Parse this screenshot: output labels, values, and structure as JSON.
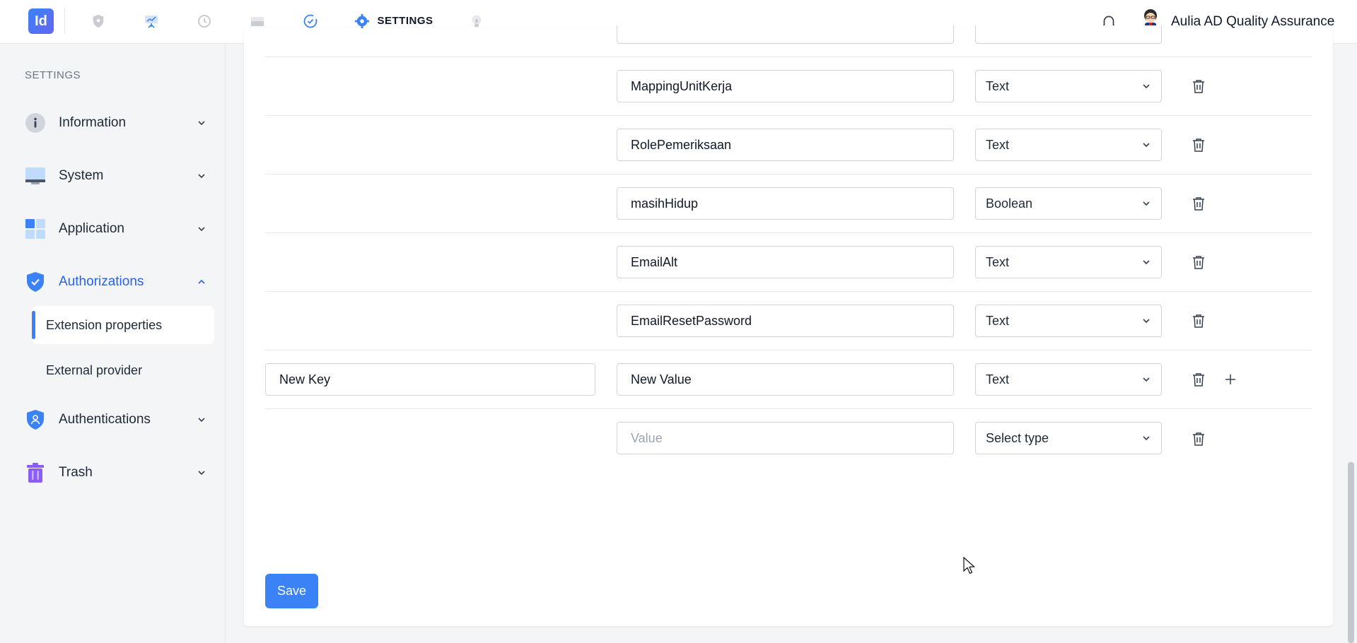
{
  "topbar": {
    "logo_text": "Id",
    "settings_label": "SETTINGS",
    "user_name": "Aulia AD Quality Assurance",
    "nav_icons": [
      "shield-icon",
      "presentation-icon",
      "history-icon",
      "drive-icon",
      "check-circle-icon",
      "gear-icon",
      "bulb-icon"
    ]
  },
  "sidebar": {
    "title": "SETTINGS",
    "items": [
      {
        "label": "Information",
        "icon": "info-icon"
      },
      {
        "label": "System",
        "icon": "monitor-icon"
      },
      {
        "label": "Application",
        "icon": "grid-icon"
      },
      {
        "label": "Authorizations",
        "icon": "shield-check-icon"
      },
      {
        "label": "Authentications",
        "icon": "shield-user-icon"
      },
      {
        "label": "Trash",
        "icon": "trash-icon"
      }
    ],
    "sub_items": [
      {
        "label": "Extension properties"
      },
      {
        "label": "External provider"
      }
    ],
    "accent": "#2563eb"
  },
  "rows": [
    {
      "value": "MappingUnitKerja",
      "type": "Text"
    },
    {
      "value": "RolePemeriksaan",
      "type": "Text"
    },
    {
      "value": "masihHidup",
      "type": "Boolean"
    },
    {
      "value": "EmailAlt",
      "type": "Text"
    },
    {
      "value": "EmailResetPassword",
      "type": "Text"
    },
    {
      "key": "New Key",
      "value": "New Value",
      "type": "Text"
    },
    {
      "value_placeholder": "Value",
      "type": "Select type"
    }
  ],
  "save_label": "Save"
}
